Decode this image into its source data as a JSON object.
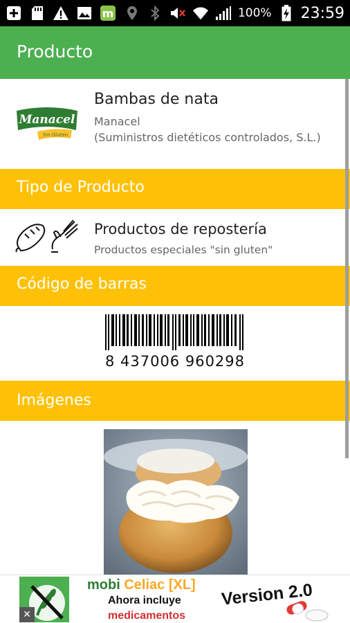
{
  "status_bar": {
    "battery_percent": "100%",
    "time": "23:59",
    "icons": [
      "add-box-icon",
      "sd-card-icon",
      "warning-icon",
      "image-icon",
      "m-app-icon",
      "location-icon",
      "bluetooth-icon",
      "mute-icon",
      "wifi-icon",
      "signal-icon",
      "battery-charging-icon"
    ]
  },
  "app_bar": {
    "title": "Producto"
  },
  "product": {
    "name": "Bambas de nata",
    "brand": "Manacel",
    "company": "(Suministros dietéticos controlados, S.L.)",
    "logo_text": "Manacel",
    "logo_subtext": "Sin Gluten"
  },
  "sections": {
    "type_header": "Tipo de Producto",
    "barcode_header": "Código de barras",
    "images_header": "Imágenes"
  },
  "product_type": {
    "title": "Productos de repostería",
    "subtitle": "Productos especiales \"sin gluten\"",
    "icons": [
      "bread-icon",
      "whisk-hand-icon"
    ]
  },
  "barcode": {
    "number": "8 437006 960298"
  },
  "image": {
    "subject": "cream-puff-photo"
  },
  "ad": {
    "brand_mobi": "mobi",
    "brand_celiac": "Celiac [XL]",
    "line1": "Ahora incluye",
    "line2": "medicamentos",
    "version": "Version 2.0",
    "close_label": "✕"
  },
  "colors": {
    "app_bar": "#4caf50",
    "section_header": "#ffc107",
    "status_bar": "#000000"
  }
}
